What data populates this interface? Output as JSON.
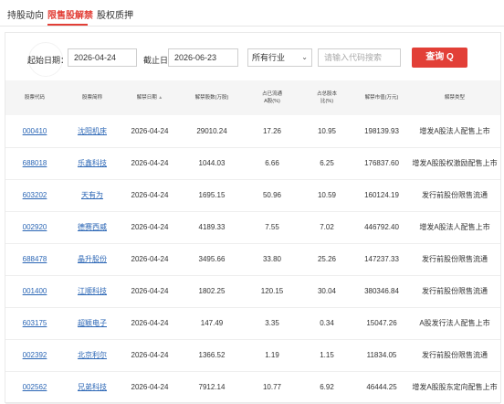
{
  "tabs": [
    {
      "label": "持股动向"
    },
    {
      "label": "限售股解禁"
    },
    {
      "label": "股权质押"
    }
  ],
  "filter": {
    "start_label": "起始日期：",
    "start_value": "2026-04-24",
    "end_label": "截止日期：",
    "end_value": "2026-06-23",
    "industry_value": "所有行业",
    "search_placeholder": "请输入代码搜索",
    "query_label": "查询 Q"
  },
  "table": {
    "headers": {
      "code": "股票代码",
      "name": "股票简称",
      "date": "解禁日期",
      "shares_1": "解禁股数",
      "shares_2": "(万股)",
      "float_pct_1": "占已流通",
      "float_pct_2": "A股(%)",
      "total_pct_1": "占总股本",
      "total_pct_2": "比(%)",
      "value_1": "解禁市值",
      "value_2": "(万元)",
      "type": "解禁类型"
    },
    "rows": [
      {
        "code": "000410",
        "name": "沈阳机床",
        "date": "2026-04-24",
        "shares": "29010.24",
        "float_pct": "17.26",
        "total_pct": "10.95",
        "value": "198139.93",
        "type": "增发A股法人配售上市"
      },
      {
        "code": "688018",
        "name": "乐鑫科技",
        "date": "2026-04-24",
        "shares": "1044.03",
        "float_pct": "6.66",
        "total_pct": "6.25",
        "value": "176837.60",
        "type": "增发A股股权激励配售上市"
      },
      {
        "code": "603202",
        "name": "天有为",
        "date": "2026-04-24",
        "shares": "1695.15",
        "float_pct": "50.96",
        "total_pct": "10.59",
        "value": "160124.19",
        "type": "发行前股份限售流通"
      },
      {
        "code": "002920",
        "name": "德赛西威",
        "date": "2026-04-24",
        "shares": "4189.33",
        "float_pct": "7.55",
        "total_pct": "7.02",
        "value": "446792.40",
        "type": "增发A股法人配售上市"
      },
      {
        "code": "688478",
        "name": "晶升股份",
        "date": "2026-04-24",
        "shares": "3495.66",
        "float_pct": "33.80",
        "total_pct": "25.26",
        "value": "147237.33",
        "type": "发行前股份限售流通"
      },
      {
        "code": "001400",
        "name": "江顺科技",
        "date": "2026-04-24",
        "shares": "1802.25",
        "float_pct": "120.15",
        "total_pct": "30.04",
        "value": "380346.84",
        "type": "发行前股份限售流通"
      },
      {
        "code": "603175",
        "name": "超颖电子",
        "date": "2026-04-24",
        "shares": "147.49",
        "float_pct": "3.35",
        "total_pct": "0.34",
        "value": "15047.26",
        "type": "A股发行法人配售上市"
      },
      {
        "code": "002392",
        "name": "北京利尔",
        "date": "2026-04-24",
        "shares": "1366.52",
        "float_pct": "1.19",
        "total_pct": "1.15",
        "value": "11834.05",
        "type": "发行前股份限售流通"
      },
      {
        "code": "002562",
        "name": "兄弟科技",
        "date": "2026-04-24",
        "shares": "7912.14",
        "float_pct": "10.77",
        "total_pct": "6.92",
        "value": "46444.25",
        "type": "增发A股股东定向配售上市"
      }
    ]
  }
}
